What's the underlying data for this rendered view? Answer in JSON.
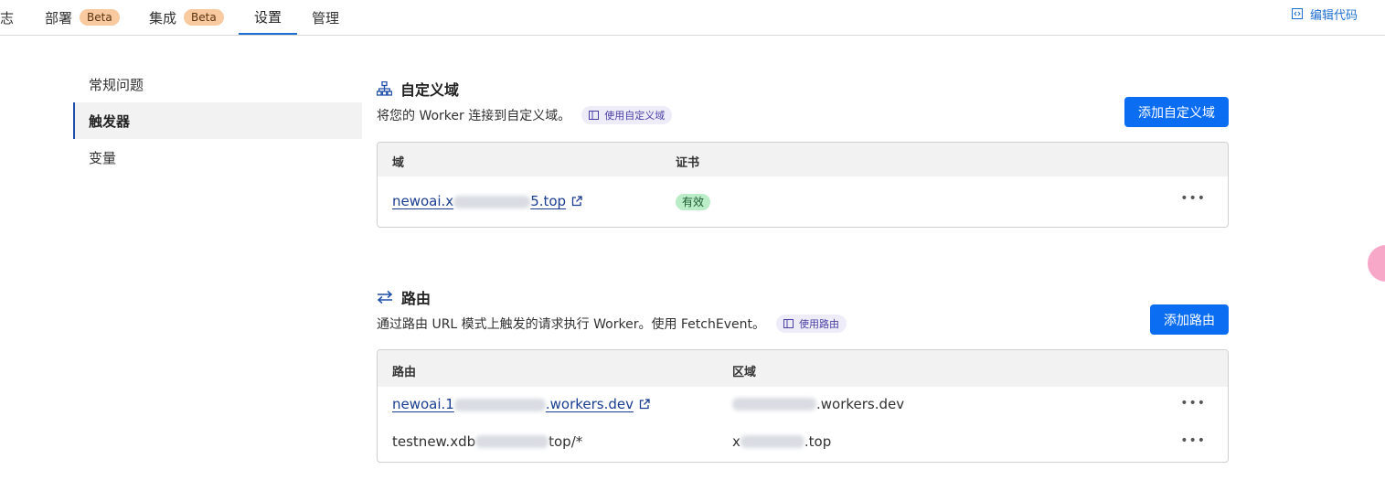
{
  "topbar": {
    "tabs": [
      {
        "label": "志",
        "badge": ""
      },
      {
        "label": "部署",
        "badge": "Beta"
      },
      {
        "label": "集成",
        "badge": "Beta"
      },
      {
        "label": "设置",
        "badge": ""
      },
      {
        "label": "管理",
        "badge": ""
      }
    ],
    "active_tab": "设置",
    "edit_code_label": "编辑代码"
  },
  "sidenav": {
    "items": [
      {
        "label": "常规问题"
      },
      {
        "label": "触发器"
      },
      {
        "label": "变量"
      }
    ],
    "active": "触发器"
  },
  "custom_domains": {
    "title": "自定义域",
    "description": "将您的 Worker 连接到自定义域。",
    "doc_link": "使用自定义域",
    "add_button": "添加自定义域",
    "columns": [
      "域",
      "证书"
    ],
    "rows": [
      {
        "domain_prefix": "newoai.x",
        "domain_suffix": "5.top",
        "certificate": "有效"
      }
    ]
  },
  "routes": {
    "title": "路由",
    "description": "通过路由 URL 模式上触发的请求执行 Worker。使用 FetchEvent。",
    "doc_link": "使用路由",
    "add_button": "添加路由",
    "columns": [
      "路由",
      "区域"
    ],
    "rows": [
      {
        "route_prefix": "newoai.1",
        "route_suffix": ".workers.dev",
        "zone_prefix": "",
        "zone_suffix": ".workers.dev"
      },
      {
        "route_prefix": "testnew.xdb",
        "route_suffix": "top/*",
        "zone_prefix": "x",
        "zone_suffix": ".top"
      }
    ]
  },
  "colors": {
    "accent": "#0b6df2",
    "link": "#1a3d8f",
    "valid_badge_bg": "#b9ecc7",
    "beta_badge_bg": "#f9c9a0"
  }
}
